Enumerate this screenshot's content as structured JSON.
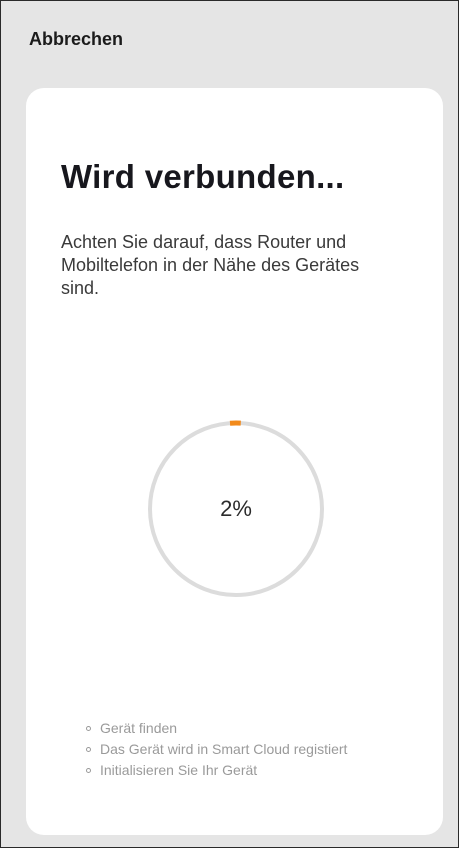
{
  "header": {
    "cancel_label": "Abbrechen"
  },
  "card": {
    "title": "Wird verbunden...",
    "description": "Achten Sie darauf, dass Router und Mobiltelefon in der Nähe des Gerätes sind."
  },
  "progress": {
    "value": 0.02,
    "label": "2%"
  },
  "steps": [
    {
      "label": "Gerät finden"
    },
    {
      "label": "Das Gerät wird in Smart Cloud registiert"
    },
    {
      "label": "Initialisieren Sie Ihr Gerät"
    }
  ],
  "colors": {
    "page_background": "#e5e5e5",
    "card_background": "#ffffff",
    "ring_track": "#dcdcdc",
    "ring_progress": "#f28a1b",
    "step_text": "#9a9a9a"
  }
}
